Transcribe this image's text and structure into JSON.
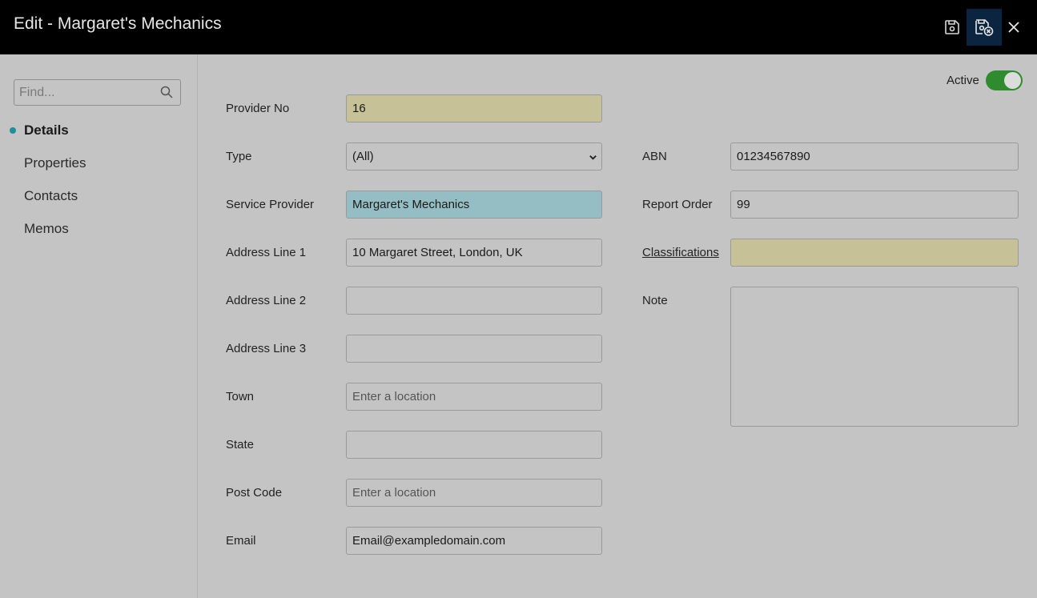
{
  "window": {
    "title": "Edit - Margaret's Mechanics"
  },
  "toolbar": {
    "icons": [
      "save-icon",
      "save-close-icon",
      "close-icon"
    ]
  },
  "sidebar": {
    "search_placeholder": "Find...",
    "items": [
      {
        "label": "Details",
        "active": true
      },
      {
        "label": "Properties",
        "active": false
      },
      {
        "label": "Contacts",
        "active": false
      },
      {
        "label": "Memos",
        "active": false
      }
    ]
  },
  "form": {
    "active": {
      "label": "Active",
      "on": true
    },
    "provider_no": {
      "label": "Provider No",
      "value": "16"
    },
    "type": {
      "label": "Type",
      "value": "(All)"
    },
    "service_provider": {
      "label": "Service Provider",
      "value": "Margaret's Mechanics"
    },
    "address1": {
      "label": "Address Line 1",
      "value": "10 Margaret Street, London, UK"
    },
    "address2": {
      "label": "Address Line 2",
      "value": ""
    },
    "address3": {
      "label": "Address Line 3",
      "value": ""
    },
    "town": {
      "label": "Town",
      "value": "",
      "placeholder": "Enter a location"
    },
    "state": {
      "label": "State",
      "value": ""
    },
    "post_code": {
      "label": "Post Code",
      "value": "",
      "placeholder": "Enter a location"
    },
    "email": {
      "label": "Email",
      "value": "Email@exampledomain.com"
    },
    "abn": {
      "label": "ABN",
      "value": "01234567890"
    },
    "report_order": {
      "label": "Report Order",
      "value": "99"
    },
    "classifications": {
      "label": "Classifications",
      "value": ""
    },
    "note": {
      "label": "Note",
      "value": ""
    }
  },
  "colors": {
    "titlebar": "#000000",
    "required_field": "#c6c196",
    "focused_field": "#94bec3",
    "toggle_on": "#2e8b2e",
    "nav_dot": "#1e8fa0"
  }
}
